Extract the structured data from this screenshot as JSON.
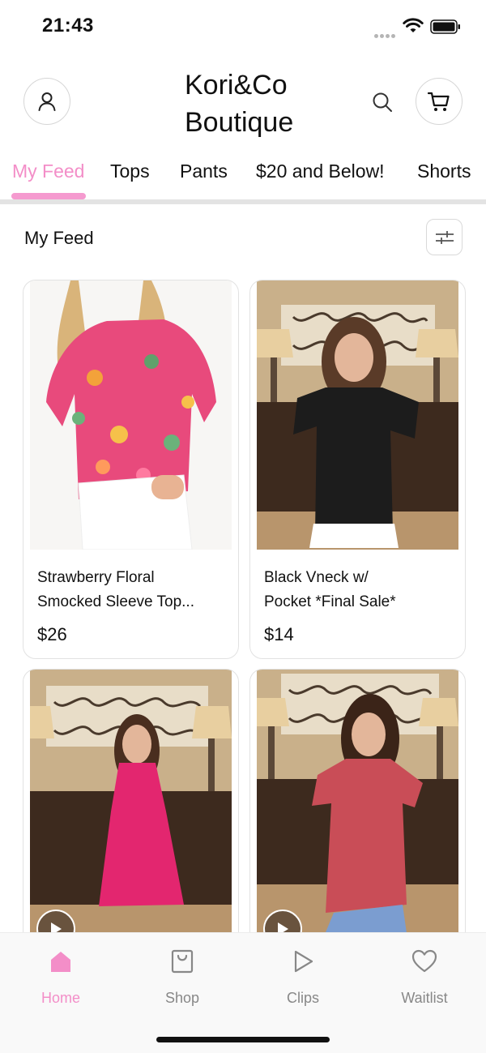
{
  "status_bar": {
    "time": "21:43"
  },
  "header": {
    "brand_line1": "Kori&Co",
    "brand_line2": "Boutique"
  },
  "tabs": [
    {
      "label": "My Feed",
      "active": true
    },
    {
      "label": "Tops",
      "active": false
    },
    {
      "label": "Pants",
      "active": false
    },
    {
      "label": "$20 and Below!",
      "active": false
    },
    {
      "label": "Shorts",
      "active": false
    }
  ],
  "feed": {
    "title": "My Feed"
  },
  "products": [
    {
      "name_line1": "Strawberry Floral",
      "name_line2": "Smocked Sleeve Top...",
      "price": "$26"
    },
    {
      "name_line1": "Black Vneck w/",
      "name_line2": "Pocket *Final Sale*",
      "price": "$14"
    },
    {
      "has_video": true
    },
    {
      "has_video": true
    }
  ],
  "bottom_nav": [
    {
      "label": "Home",
      "icon": "home-icon",
      "active": true
    },
    {
      "label": "Shop",
      "icon": "shopping-bag-icon",
      "active": false
    },
    {
      "label": "Clips",
      "icon": "play-icon",
      "active": false
    },
    {
      "label": "Waitlist",
      "icon": "heart-icon",
      "active": false
    }
  ],
  "colors": {
    "accent": "#f38ec8",
    "accent_bar": "#f59acf",
    "inactive": "#888888"
  }
}
